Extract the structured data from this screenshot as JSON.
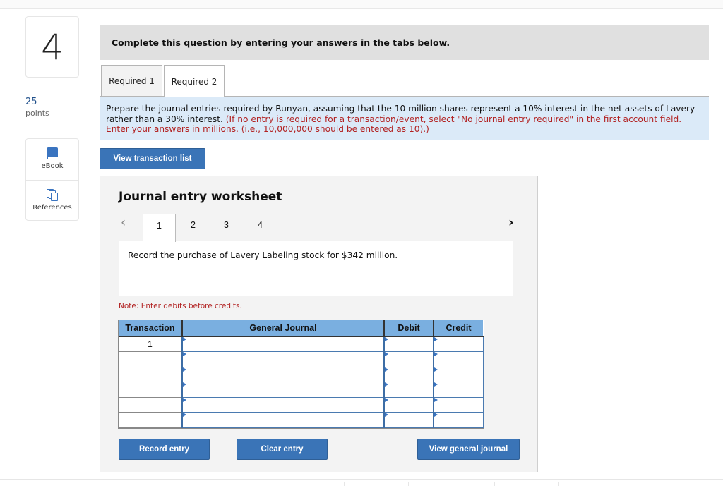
{
  "question": {
    "number": "4",
    "points_value": "25",
    "points_label": "points"
  },
  "tools": [
    {
      "label": "eBook",
      "icon": "book-icon"
    },
    {
      "label": "References",
      "icon": "copy-pages-icon"
    }
  ],
  "instruction": "Complete this question by entering your answers in the tabs below.",
  "tabs": [
    {
      "label": "Required 1",
      "active": false
    },
    {
      "label": "Required 2",
      "active": true
    }
  ],
  "prompt": {
    "main": "Prepare the journal entries required by Runyan, assuming that the 10 million shares represent a 10% interest in the net assets of Lavery rather than a 30% interest.",
    "hint": "(If no entry is required for a transaction/event, select \"No journal entry required\" in the first account field. Enter your answers in millions. (i.e., 10,000,000 should be entered as 10).)"
  },
  "view_transaction_list_label": "View transaction list",
  "worksheet": {
    "title": "Journal entry worksheet",
    "prev_icon": "chevron-left-icon",
    "next_icon": "chevron-right-icon",
    "steps": [
      "1",
      "2",
      "3",
      "4"
    ],
    "active_step": "1",
    "description": "Record the purchase of Lavery Labeling stock for $342 million.",
    "note": "Note: Enter debits before credits.",
    "table": {
      "headers": [
        "Transaction",
        "General Journal",
        "Debit",
        "Credit"
      ],
      "rows": [
        {
          "transaction": "1",
          "account": "",
          "debit": "",
          "credit": ""
        },
        {
          "transaction": "",
          "account": "",
          "debit": "",
          "credit": ""
        },
        {
          "transaction": "",
          "account": "",
          "debit": "",
          "credit": ""
        },
        {
          "transaction": "",
          "account": "",
          "debit": "",
          "credit": ""
        },
        {
          "transaction": "",
          "account": "",
          "debit": "",
          "credit": ""
        },
        {
          "transaction": "",
          "account": "",
          "debit": "",
          "credit": ""
        }
      ]
    },
    "buttons": {
      "record": "Record entry",
      "clear": "Clear entry",
      "view_journal": "View general journal"
    }
  }
}
